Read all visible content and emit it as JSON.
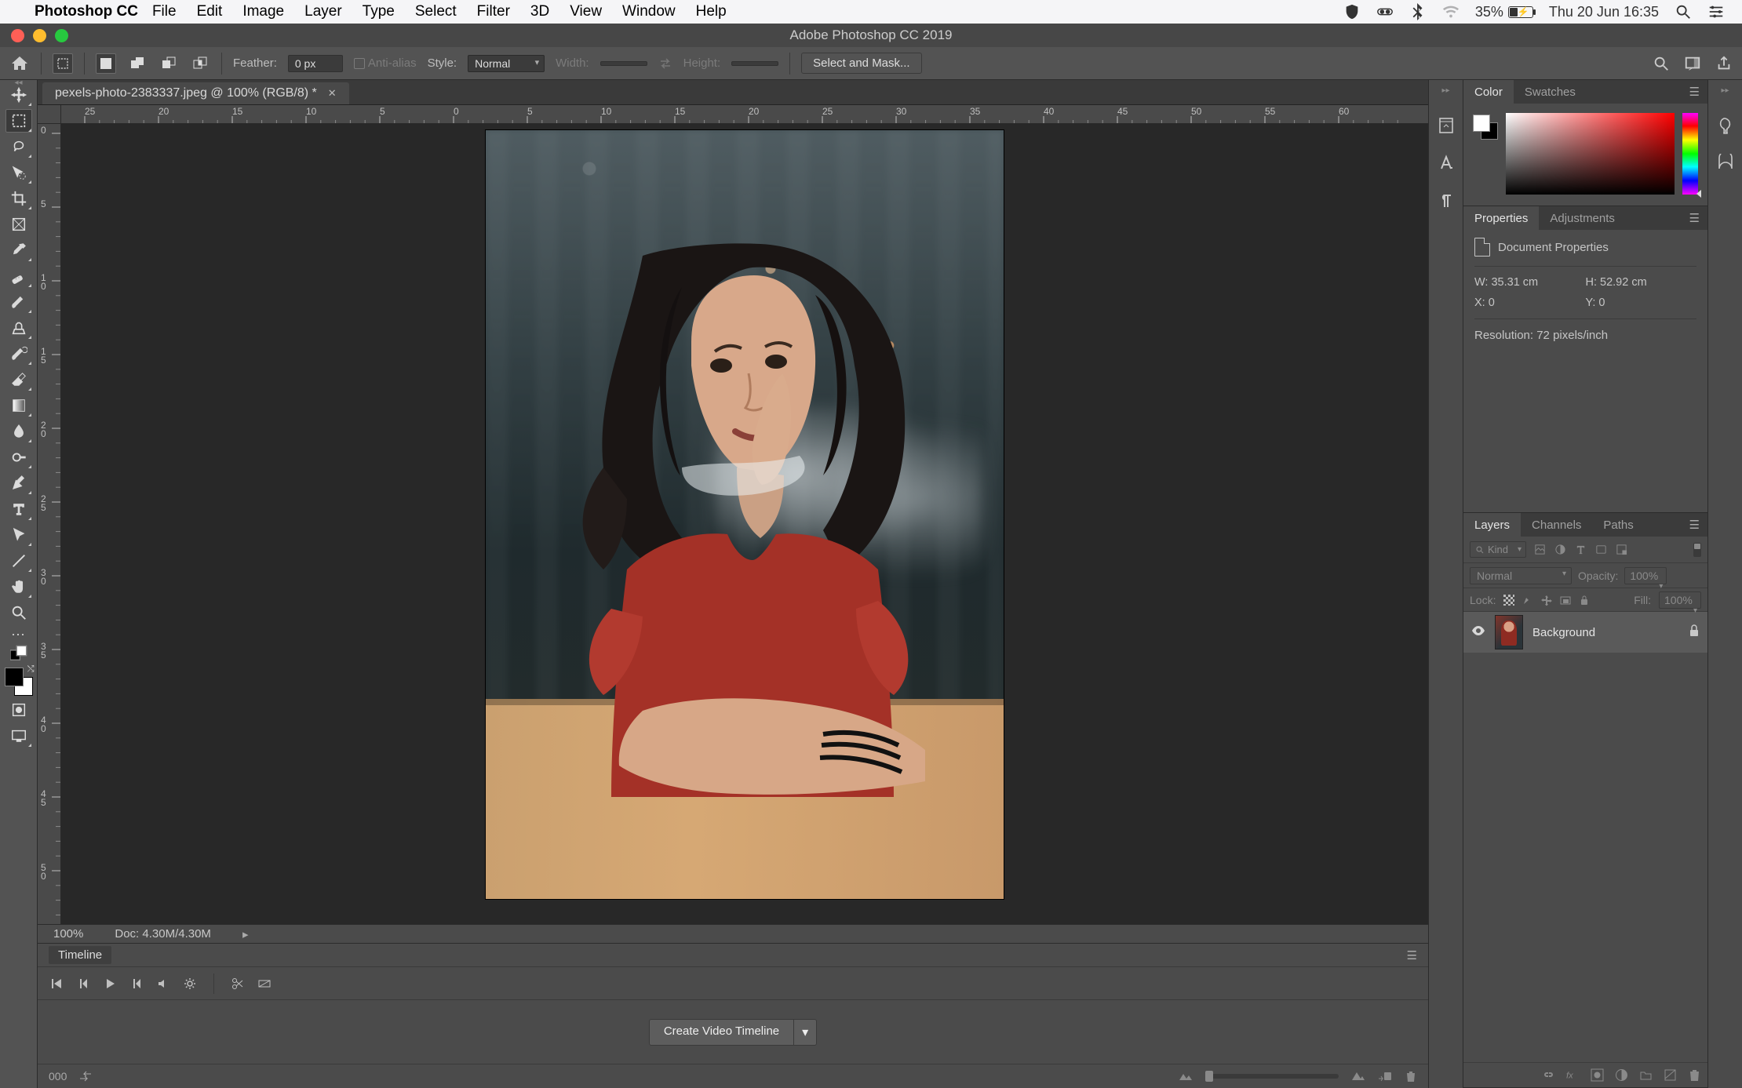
{
  "mac_menu": {
    "app_name": "Photoshop CC",
    "items": [
      "File",
      "Edit",
      "Image",
      "Layer",
      "Type",
      "Select",
      "Filter",
      "3D",
      "View",
      "Window",
      "Help"
    ],
    "battery_pct": "35%",
    "datetime": "Thu 20 Jun  16:35"
  },
  "window_title": "Adobe Photoshop CC 2019",
  "options_bar": {
    "feather_label": "Feather:",
    "feather_value": "0 px",
    "anti_alias_label": "Anti-alias",
    "style_label": "Style:",
    "style_value": "Normal",
    "width_label": "Width:",
    "height_label": "Height:",
    "select_mask_label": "Select and Mask..."
  },
  "document_tab": "pexels-photo-2383337.jpeg @ 100% (RGB/8) *",
  "status": {
    "zoom": "100%",
    "docsize": "Doc: 4.30M/4.30M"
  },
  "timeline": {
    "tab": "Timeline",
    "button": "Create Video Timeline",
    "frame_counter": "000"
  },
  "panels": {
    "color": {
      "tab1": "Color",
      "tab2": "Swatches"
    },
    "properties": {
      "tab1": "Properties",
      "tab2": "Adjustments",
      "title": "Document Properties",
      "w": "W: 35.31 cm",
      "h": "H: 52.92 cm",
      "x": "X: 0",
      "y": "Y: 0",
      "resolution": "Resolution: 72 pixels/inch"
    },
    "layers": {
      "tab1": "Layers",
      "tab2": "Channels",
      "tab3": "Paths",
      "filter_kind": "Kind",
      "blend_mode": "Normal",
      "opacity_label": "Opacity:",
      "opacity_value": "100%",
      "lock_label": "Lock:",
      "fill_label": "Fill:",
      "fill_value": "100%",
      "layer_name": "Background"
    }
  },
  "ruler_h_labels": [
    "25",
    "20",
    "15",
    "10",
    "5",
    "0",
    "5",
    "10",
    "15",
    "20",
    "25",
    "30",
    "35",
    "40",
    "45",
    "50",
    "55",
    "60"
  ],
  "ruler_v_labels": [
    "0",
    "5",
    "1\n0",
    "1\n5",
    "2\n0",
    "2\n5",
    "3\n0",
    "3\n5",
    "4\n0",
    "4\n5",
    "5\n0"
  ]
}
